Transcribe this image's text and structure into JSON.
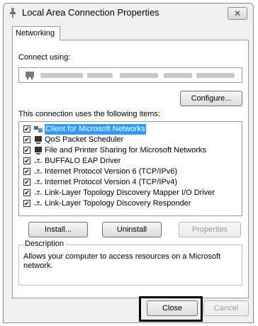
{
  "window": {
    "title": "Local Area Connection Properties",
    "close_label": "✕"
  },
  "tabs": [
    {
      "label": "Networking"
    }
  ],
  "connect_using_label": "Connect using:",
  "configure_label": "Configure...",
  "items_label": "This connection uses the following items:",
  "items": [
    {
      "label": "Client for Microsoft Networks",
      "checked": true,
      "selected": true,
      "icon": "client-network-icon"
    },
    {
      "label": "QoS Packet Scheduler",
      "checked": true,
      "icon": "monitor-icon"
    },
    {
      "label": "File and Printer Sharing for Microsoft Networks",
      "checked": true,
      "icon": "monitor-icon"
    },
    {
      "label": "BUFFALO EAP Driver",
      "checked": true,
      "icon": "protocol-icon"
    },
    {
      "label": "Internet Protocol Version 6 (TCP/IPv6)",
      "checked": true,
      "icon": "protocol-icon"
    },
    {
      "label": "Internet Protocol Version 4 (TCP/IPv4)",
      "checked": true,
      "icon": "protocol-icon"
    },
    {
      "label": "Link-Layer Topology Discovery Mapper I/O Driver",
      "checked": true,
      "icon": "protocol-icon"
    },
    {
      "label": "Link-Layer Topology Discovery Responder",
      "checked": true,
      "icon": "protocol-icon"
    }
  ],
  "buttons": {
    "install": "Install...",
    "uninstall": "Uninstall",
    "properties": "Properties",
    "close": "Close",
    "cancel": "Cancel"
  },
  "description": {
    "legend": "Description",
    "text": "Allows your computer to access resources on a Microsoft network."
  },
  "checkmark": "✔"
}
